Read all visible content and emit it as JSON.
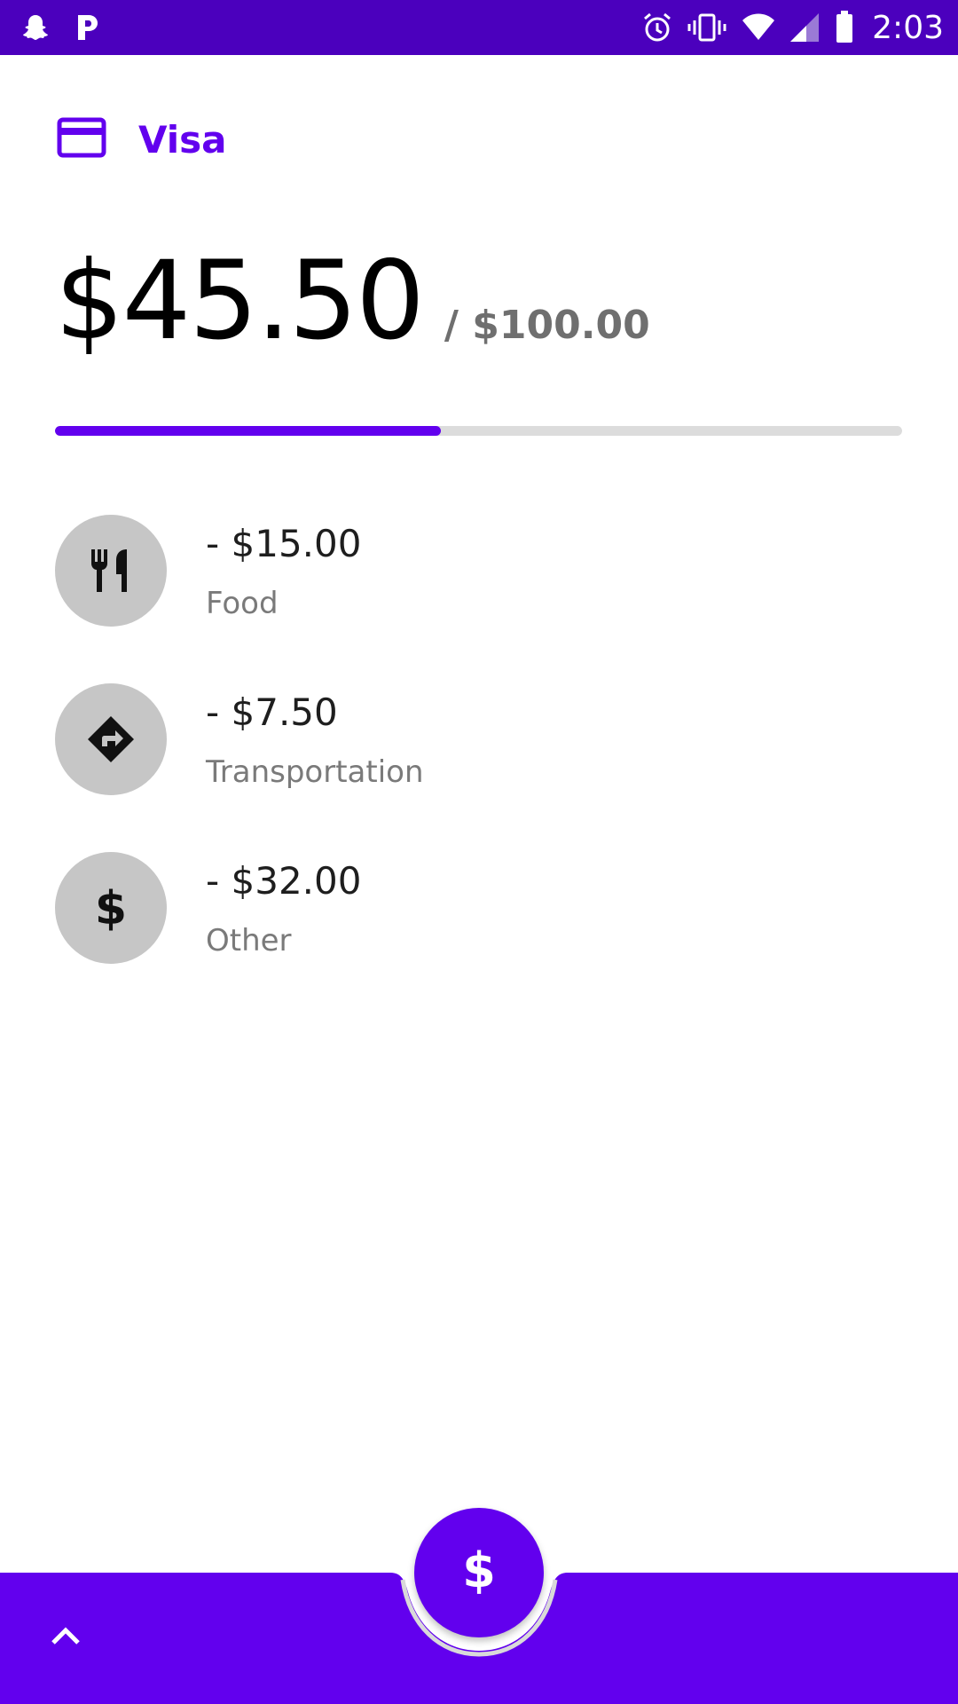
{
  "status_bar": {
    "time": "2:03",
    "left_icons": [
      "snapchat-icon",
      "p-app-icon"
    ],
    "right_icons": [
      "alarm-icon",
      "vibrate-icon",
      "wifi-icon",
      "signal-icon",
      "battery-icon"
    ]
  },
  "card": {
    "icon": "credit-card-icon",
    "name": "Visa"
  },
  "budget": {
    "spent": "$45.50",
    "total": "/ $100.00",
    "progress_fraction": 0.455
  },
  "transactions": [
    {
      "amount": "- $15.00",
      "category": "Food",
      "icon": "restaurant-icon"
    },
    {
      "amount": "- $7.50",
      "category": "Transportation",
      "icon": "directions-icon"
    },
    {
      "amount": "- $32.00",
      "category": "Other",
      "icon": "dollar-icon"
    }
  ],
  "bottom_bar": {
    "expand_icon": "chevron-up-icon",
    "fab_icon": "dollar-icon"
  },
  "colors": {
    "status_bar": "#4b00bd",
    "accent": "#6200ee",
    "avatar_bg": "#c6c6c6",
    "track": "#dcdcdc"
  }
}
